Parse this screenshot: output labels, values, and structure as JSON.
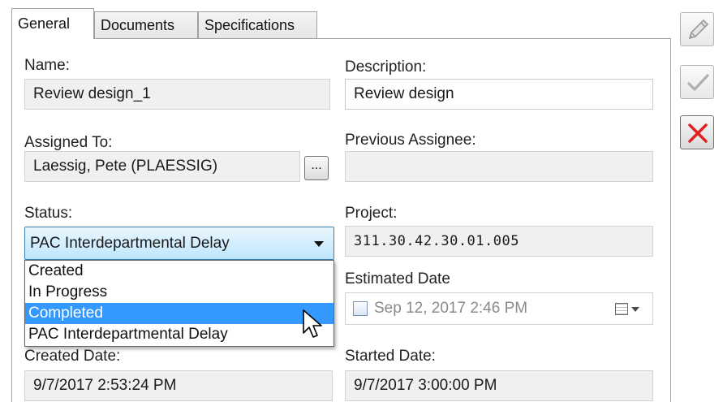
{
  "tabs": [
    {
      "label": "General",
      "active": true
    },
    {
      "label": "Documents",
      "active": false
    },
    {
      "label": "Specifications",
      "active": false
    }
  ],
  "form": {
    "name_label": "Name:",
    "name_value": "Review design_1",
    "description_label": "Description:",
    "description_value": "Review design",
    "assigned_to_label": "Assigned To:",
    "assigned_to_value": "Laessig, Pete (PLAESSIG)",
    "browse_button_label": "...",
    "previous_assignee_label": "Previous Assignee:",
    "previous_assignee_value": "",
    "status_label": "Status:",
    "status_value": "PAC Interdepartmental Delay",
    "status_options": [
      "Created",
      "In Progress",
      "Completed",
      "PAC Interdepartmental Delay"
    ],
    "status_highlighted_option": "Completed",
    "project_label": "Project:",
    "project_value": "311.30.42.30.01.005",
    "estimated_date_label": "Estimated Date",
    "estimated_date_value": "Sep 12, 2017   2:46 PM",
    "estimated_date_checked": false,
    "created_date_label": "Created Date:",
    "created_date_value": "9/7/2017 2:53:24 PM",
    "started_date_label": "Started Date:",
    "started_date_value": "9/7/2017 3:00:00 PM"
  },
  "side_buttons": [
    {
      "icon": "pencil-icon",
      "enabled": false
    },
    {
      "icon": "checkmark-icon",
      "enabled": false
    },
    {
      "icon": "red-x-icon",
      "enabled": true,
      "color": "#e02020"
    }
  ],
  "colors": {
    "dropdown_highlight": "#3399ff",
    "combo_border": "#3c7fb1",
    "cancel_red": "#e02020"
  }
}
